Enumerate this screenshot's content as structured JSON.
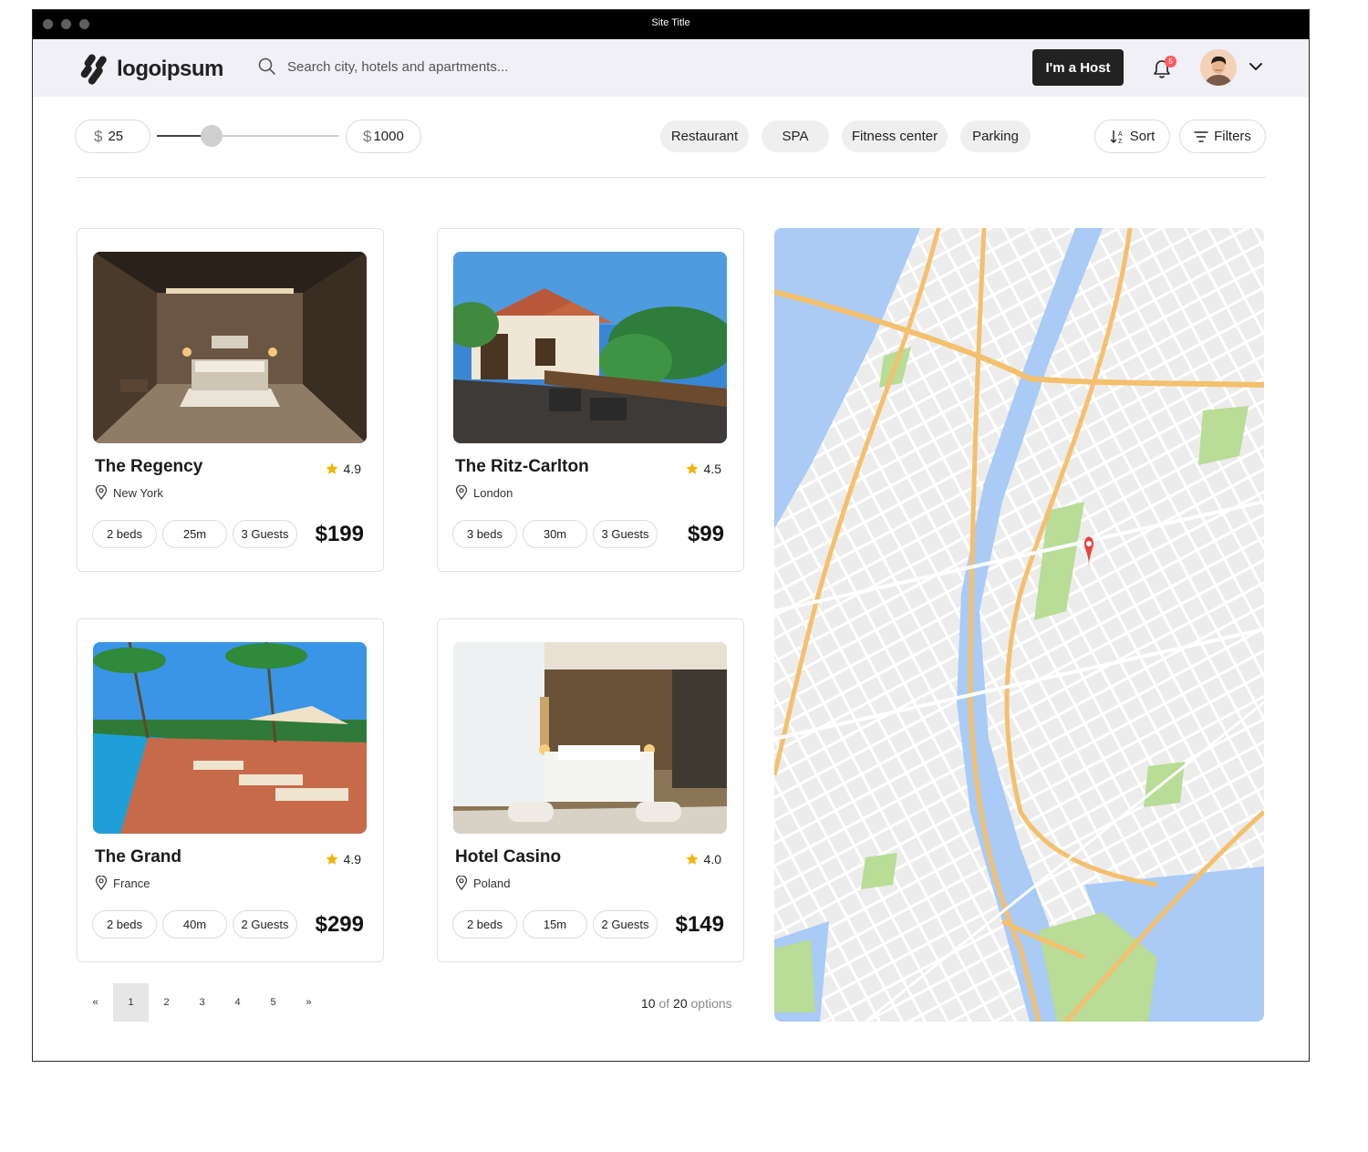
{
  "window": {
    "title": "Site Title"
  },
  "header": {
    "logo": "logoipsum",
    "search_placeholder": "Search city, hotels and apartments...",
    "host_button": "I'm a Host",
    "notification_count": "5"
  },
  "filters": {
    "currency": "$",
    "min_price": "25",
    "max_price": "1000",
    "price_range_fill": 0.3,
    "chips": [
      "Restaurant",
      "SPA",
      "Fitness center",
      "Parking"
    ],
    "sort_label": "Sort",
    "filters_label": "Filters"
  },
  "hotels": [
    {
      "name": "The Regency",
      "rating": "4.9",
      "location": "New York",
      "beds": "2 beds",
      "size": "25m",
      "guests": "3 Guests",
      "price": "$199"
    },
    {
      "name": "The Ritz-Carlton",
      "rating": "4.5",
      "location": "London",
      "beds": "3 beds",
      "size": "30m",
      "guests": "3 Guests",
      "price": "$99"
    },
    {
      "name": "The Grand",
      "rating": "4.9",
      "location": "France",
      "beds": "2 beds",
      "size": "40m",
      "guests": "2 Guests",
      "price": "$299"
    },
    {
      "name": "Hotel Casino",
      "rating": "4.0",
      "location": "Poland",
      "beds": "2 beds",
      "size": "15m",
      "guests": "2 Guests",
      "price": "$149"
    }
  ],
  "pagination": {
    "prev": "«",
    "pages": [
      "1",
      "2",
      "3",
      "4",
      "5"
    ],
    "next": "»",
    "current_page": "1",
    "shown": "10",
    "of_word": "of",
    "total": "20",
    "options_word": "options"
  },
  "colors": {
    "accent": "#222222",
    "badge": "#ff5a5a",
    "star": "#f5b301",
    "map_water": "#a9cbf5",
    "map_road": "#f4c06e",
    "map_park": "#b9dc96",
    "map_pin": "#e8443a"
  },
  "icons": {
    "search": "search-icon",
    "bell": "bell-icon",
    "chevron": "chevron-down-icon",
    "star": "star-icon",
    "location": "location-pin-icon",
    "sort": "sort-icon",
    "filter": "filter-icon"
  }
}
